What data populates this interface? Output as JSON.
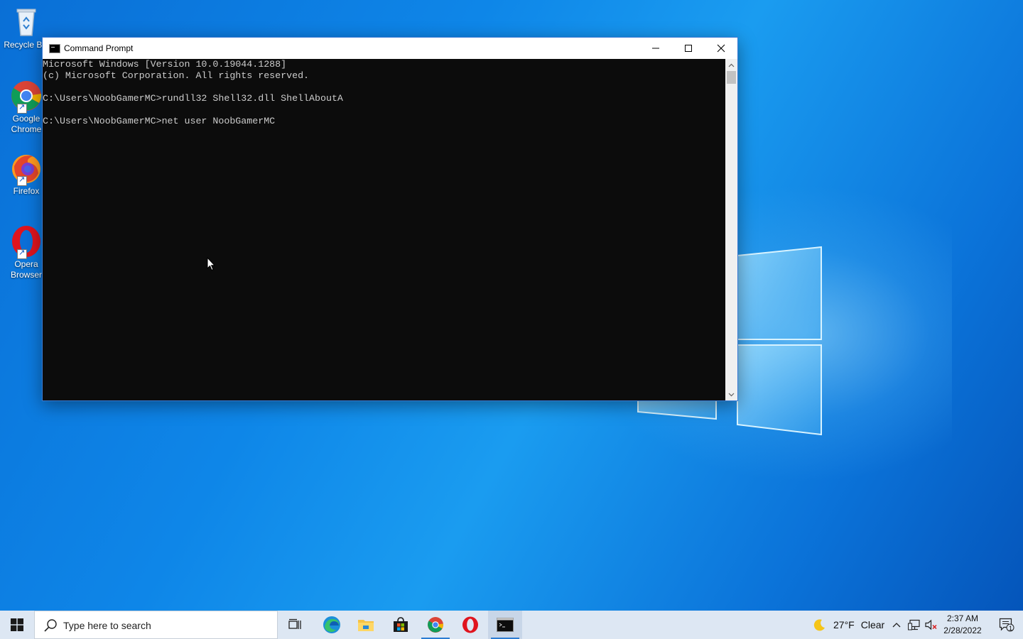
{
  "desktop": {
    "icons": [
      {
        "label": "Recycle Bin"
      },
      {
        "label": "Google Chrome"
      },
      {
        "label": "Firefox"
      },
      {
        "label": "Opera Browser"
      }
    ]
  },
  "window": {
    "title": "Command Prompt",
    "buttons": {
      "minimize": "minimize-icon",
      "maximize": "maximize-icon",
      "close": "close-icon"
    },
    "console_lines": [
      "Microsoft Windows [Version 10.0.19044.1288]",
      "(c) Microsoft Corporation. All rights reserved.",
      "",
      "C:\\Users\\NoobGamerMC>rundll32 Shell32.dll ShellAboutA",
      "",
      "C:\\Users\\NoobGamerMC>net user NoobGamerMC"
    ]
  },
  "taskbar": {
    "search_placeholder": "Type here to search",
    "apps": [
      "task-view-icon",
      "edge-icon",
      "file-explorer-icon",
      "store-icon",
      "chrome-icon",
      "opera-icon",
      "command-prompt-icon"
    ],
    "active_app": "command-prompt-icon",
    "weather": {
      "temp": "27°F",
      "condition": "Clear"
    },
    "clock": {
      "time": "2:37 AM",
      "date": "2/28/2022"
    },
    "notification_count": "1"
  },
  "colors": {
    "accent": "#2b7cd3",
    "console_bg": "#0c0c0c",
    "console_text": "#cccccc",
    "taskbar_bg": "#dde7f3"
  }
}
